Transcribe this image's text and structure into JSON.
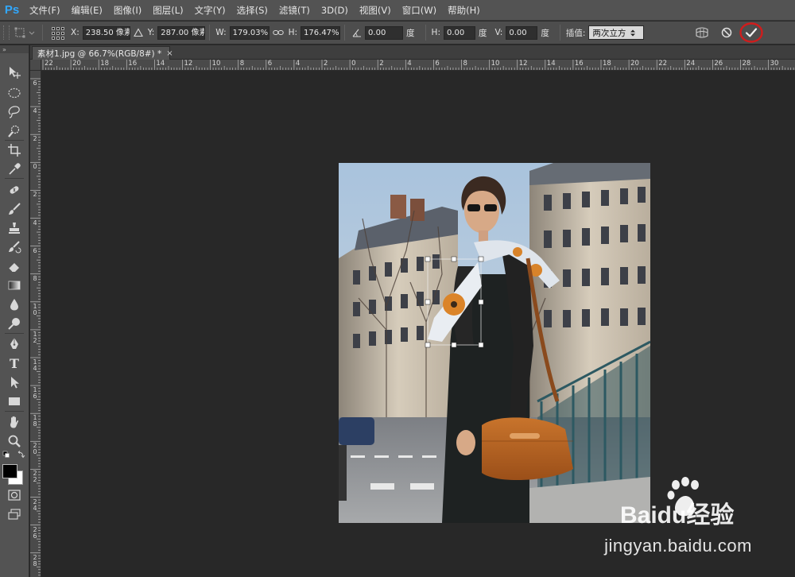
{
  "app": {
    "logo_text": "Ps"
  },
  "menu": [
    {
      "label": "文件(F)"
    },
    {
      "label": "编辑(E)"
    },
    {
      "label": "图像(I)"
    },
    {
      "label": "图层(L)"
    },
    {
      "label": "文字(Y)"
    },
    {
      "label": "选择(S)"
    },
    {
      "label": "滤镜(T)"
    },
    {
      "label": "3D(D)"
    },
    {
      "label": "视图(V)"
    },
    {
      "label": "窗口(W)"
    },
    {
      "label": "帮助(H)"
    }
  ],
  "options": {
    "x_label": "X:",
    "x_value": "238.50 像素",
    "y_label": "Y:",
    "y_value": "287.00 像素",
    "w_label": "W:",
    "w_value": "179.03%",
    "h_label": "H:",
    "h_value": "176.47%",
    "angle_value": "0.00",
    "angle_unit": "度",
    "hskew_label": "H:",
    "hskew_value": "0.00",
    "hskew_unit": "度",
    "vskew_label": "V:",
    "vskew_value": "0.00",
    "vskew_unit": "度",
    "interp_label": "插值:",
    "interp_value": "两次立方",
    "icons": {
      "tool": "transform-icon",
      "reference_point": "reference-point-grid-icon",
      "delta": "delta-icon",
      "link": "link-icon",
      "angle": "angle-icon",
      "warp": "warp-icon",
      "cancel": "cancel-icon",
      "commit": "commit-check-icon"
    },
    "commit_highlight_color": "#d01c1c"
  },
  "document": {
    "tab_title": "素材1.jpg @ 66.7%(RGB/8#) *",
    "tab_close": "×"
  },
  "ruler": {
    "top_labels": [
      "22",
      "20",
      "18",
      "16",
      "14",
      "12",
      "10",
      "8",
      "6",
      "4",
      "2",
      "0",
      "2",
      "4",
      "6",
      "8",
      "10",
      "12",
      "14",
      "16",
      "18",
      "20",
      "22",
      "24",
      "26",
      "28",
      "30",
      "32"
    ],
    "left_labels": [
      "6",
      "4",
      "2",
      "0",
      "2",
      "4",
      "6",
      "8",
      "10",
      "12",
      "14",
      "16",
      "18",
      "20",
      "22",
      "24",
      "26",
      "28"
    ]
  },
  "toolbar": {
    "header_glyph": "»",
    "tools": [
      "move-tool-icon",
      "marquee-tool-icon",
      "lasso-tool-icon",
      "quick-select-tool-icon",
      "crop-tool-icon",
      "eyedropper-tool-icon",
      "healing-brush-tool-icon",
      "brush-tool-icon",
      "clone-stamp-tool-icon",
      "history-brush-tool-icon",
      "eraser-tool-icon",
      "gradient-tool-icon",
      "blur-tool-icon",
      "dodge-tool-icon",
      "pen-tool-icon",
      "type-tool-icon",
      "path-select-tool-icon",
      "rectangle-tool-icon",
      "hand-tool-icon",
      "zoom-tool-icon",
      "quick-mask-icon",
      "screen-mode-icon"
    ],
    "type_glyph": "T",
    "foreground_color": "#000000",
    "background_color": "#ffffff"
  },
  "watermark": {
    "brand": "Baidu经验",
    "url": "jingyan.baidu.com"
  }
}
